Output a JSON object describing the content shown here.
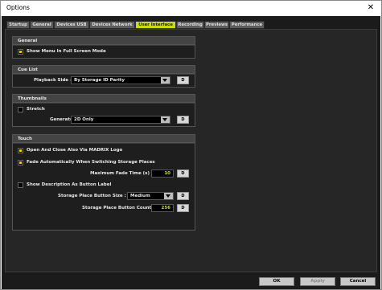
{
  "window": {
    "title": "Options",
    "close_glyph": "✕"
  },
  "tabs": [
    "Startup",
    "General",
    "Devices USB",
    "Devices Network",
    "User Interface",
    "Recording",
    "Previews",
    "Performance"
  ],
  "active_tab": "User Interface",
  "groups": {
    "general": {
      "title": "General",
      "show_menu_fullscreen": {
        "label": "Show Menu In Full Screen Mode",
        "checked": true
      }
    },
    "cue_list": {
      "title": "Cue List",
      "playback_side": {
        "label": "Playback Side :",
        "value": "By Storage ID Parity",
        "default_label": "D"
      }
    },
    "thumbnails": {
      "title": "Thumbnails",
      "stretch": {
        "label": "Stretch",
        "checked": false
      },
      "generate": {
        "label": "Generate :",
        "value": "2D Only",
        "default_label": "D"
      }
    },
    "touch": {
      "title": "Touch",
      "open_close_logo": {
        "label": "Open And Close Also Via MADRIX Logo",
        "checked": true
      },
      "fade_auto": {
        "label": "Fade Automatically When Switching Storage Places",
        "checked": true
      },
      "max_fade_time": {
        "label": "Maximum Fade Time (s) :",
        "value": "10",
        "default_label": "D"
      },
      "show_description": {
        "label": "Show Description As Button Label",
        "checked": false
      },
      "button_size": {
        "label": "Storage Place Button Size :",
        "value": "Medium",
        "default_label": "D"
      },
      "button_count": {
        "label": "Storage Place Button Count :",
        "value": "256",
        "default_label": "D"
      }
    }
  },
  "buttons": {
    "ok": "OK",
    "apply": "Apply",
    "cancel": "Cancel"
  }
}
